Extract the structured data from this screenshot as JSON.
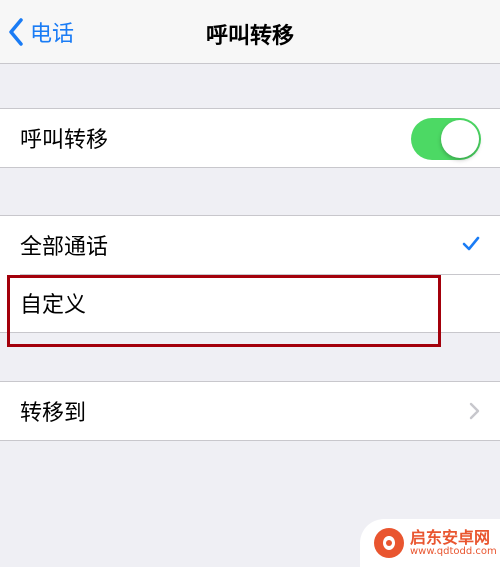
{
  "nav": {
    "back_label": "电话",
    "title": "呼叫转移"
  },
  "forwarding_toggle": {
    "label": "呼叫转移",
    "enabled": true,
    "on_color": "#4cd964"
  },
  "scope_options": [
    {
      "label": "全部通话",
      "selected": true
    },
    {
      "label": "自定义",
      "selected": false
    }
  ],
  "forward_to": {
    "label": "转移到"
  },
  "watermark": {
    "name": "启东安卓网",
    "url": "www.qdtodd.com"
  },
  "colors": {
    "accent": "#1a7cf5",
    "highlight_box": "#a3000b",
    "background": "#efeff4"
  }
}
